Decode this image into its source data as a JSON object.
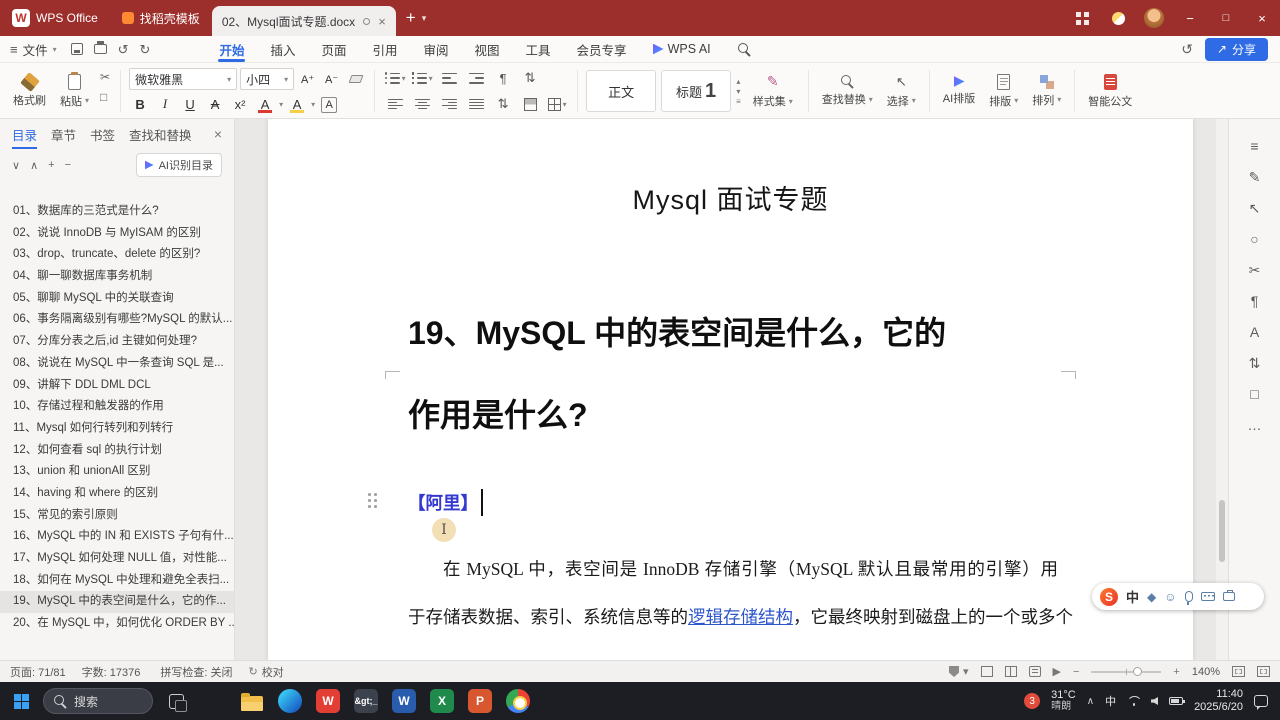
{
  "glyphs": {
    "menu": "≡",
    "caret": "▾",
    "caret_up": "▴",
    "chevron_up": "∧",
    "chevron_down": "∨",
    "plus": "+",
    "minus": "−",
    "close": "×",
    "undo": "↺",
    "redo": "↻",
    "scissors": "✂",
    "pilcrow": "¶",
    "select_arrow": "↖",
    "play": "▶",
    "ellipsis": "…",
    "updown": "⇅",
    "square": "□",
    "circle": "○",
    "share_arrow": "↗",
    "smiley": "☺",
    "diamond": "◆",
    "letter_a": "A",
    "styleset": "✎"
  },
  "titlebar": {
    "logo_letter": "W",
    "app_name": "WPS Office",
    "home_tab": "找稻壳模板",
    "doc_tab": "02、Mysql面试专题.docx"
  },
  "menubar": {
    "file_label": "文件",
    "tabs": [
      "开始",
      "插入",
      "页面",
      "引用",
      "审阅",
      "视图",
      "工具",
      "会员专享",
      "WPS AI"
    ],
    "share_label": "分享"
  },
  "ribbon": {
    "format_painter": "格式刷",
    "paste": "粘贴",
    "font_name": "微软雅黑",
    "font_size": "小四",
    "grow": "A⁺",
    "shrink": "A⁻",
    "font_buttons": [
      "B",
      "I",
      "U",
      "A",
      "x²",
      "A",
      "A",
      "A"
    ],
    "style_normal": "正文",
    "style_heading": "标题",
    "style_heading_num": "1",
    "style_set": "样式集",
    "find_replace": "查找替换",
    "select_label": "选择",
    "ai_layout": "AI排版",
    "layout": "排版",
    "arrange": "排列",
    "smart_doc": "智能公文"
  },
  "sidebar": {
    "tabs": [
      "目录",
      "章节",
      "书签",
      "查找和替换"
    ],
    "ai_button": "AI识别目录",
    "items": [
      "01、数据库的三范式是什么?",
      "02、说说 InnoDB 与 MyISAM 的区别",
      "03、drop、truncate、delete 的区别?",
      "04、聊一聊数据库事务机制",
      "05、聊聊 MySQL 中的关联查询",
      "06、事务隔离级别有哪些?MySQL 的默认...",
      "07、分库分表之后,id 主键如何处理?",
      "08、说说在 MySQL 中一条查询 SQL 是...",
      "09、讲解下 DDL DML DCL",
      "10、存储过程和触发器的作用",
      "11、Mysql 如何行转列和列转行",
      "12、如何查看 sql 的执行计划",
      "13、union 和 unionAll 区别",
      "14、having 和 where 的区别",
      "15、常见的索引原则",
      "16、MySQL 中的 IN 和 EXISTS 子句有什...",
      "17、MySQL 如何处理 NULL 值，对性能...",
      "18、如何在 MySQL 中处理和避免全表扫...",
      "19、MySQL 中的表空间是什么，它的作...",
      "20、在 MySQL 中，如何优化 ORDER BY ..."
    ]
  },
  "document": {
    "title": "Mysql 面试专题",
    "heading_line1": "19、MySQL 中的表空间是什么，它的",
    "heading_line2": "作用是什么?",
    "tag": "【阿里】",
    "cursor_glyph": "I",
    "body_line1": "在 MySQL 中，表空间是 InnoDB 存储引擎（MySQL 默认且最常用的引擎）用",
    "body_line2_pre": "于存储表数据、索引、系统信息等的",
    "body_link": "逻辑存储结构",
    "body_line2_post": "，它最终映射到磁盘上的一个或多个"
  },
  "ime": {
    "logo_letter": "S",
    "mode": "中"
  },
  "statusbar": {
    "page": "页面: 71/81",
    "words": "字数: 17376",
    "spell": "拼写检查: 关闭",
    "proof": "校对",
    "zoom": "140%"
  },
  "taskbar": {
    "search_label": "搜索",
    "app_letters": {
      "wps": "W",
      "terminal": "&gt;_",
      "word": "W",
      "excel": "X",
      "ppt": "P"
    },
    "badge": "3",
    "weather_temp": "31°C",
    "weather_desc": "晴朗",
    "tray_ime": "中",
    "time": "11:40",
    "date": "2025/6/20"
  },
  "colors": {
    "titlebar": "#9c2f2b",
    "accent_blue": "#2f6be4",
    "tag_blue": "#3339cf",
    "link_blue": "#2e56cc",
    "taskbar": "#1c1e23"
  }
}
